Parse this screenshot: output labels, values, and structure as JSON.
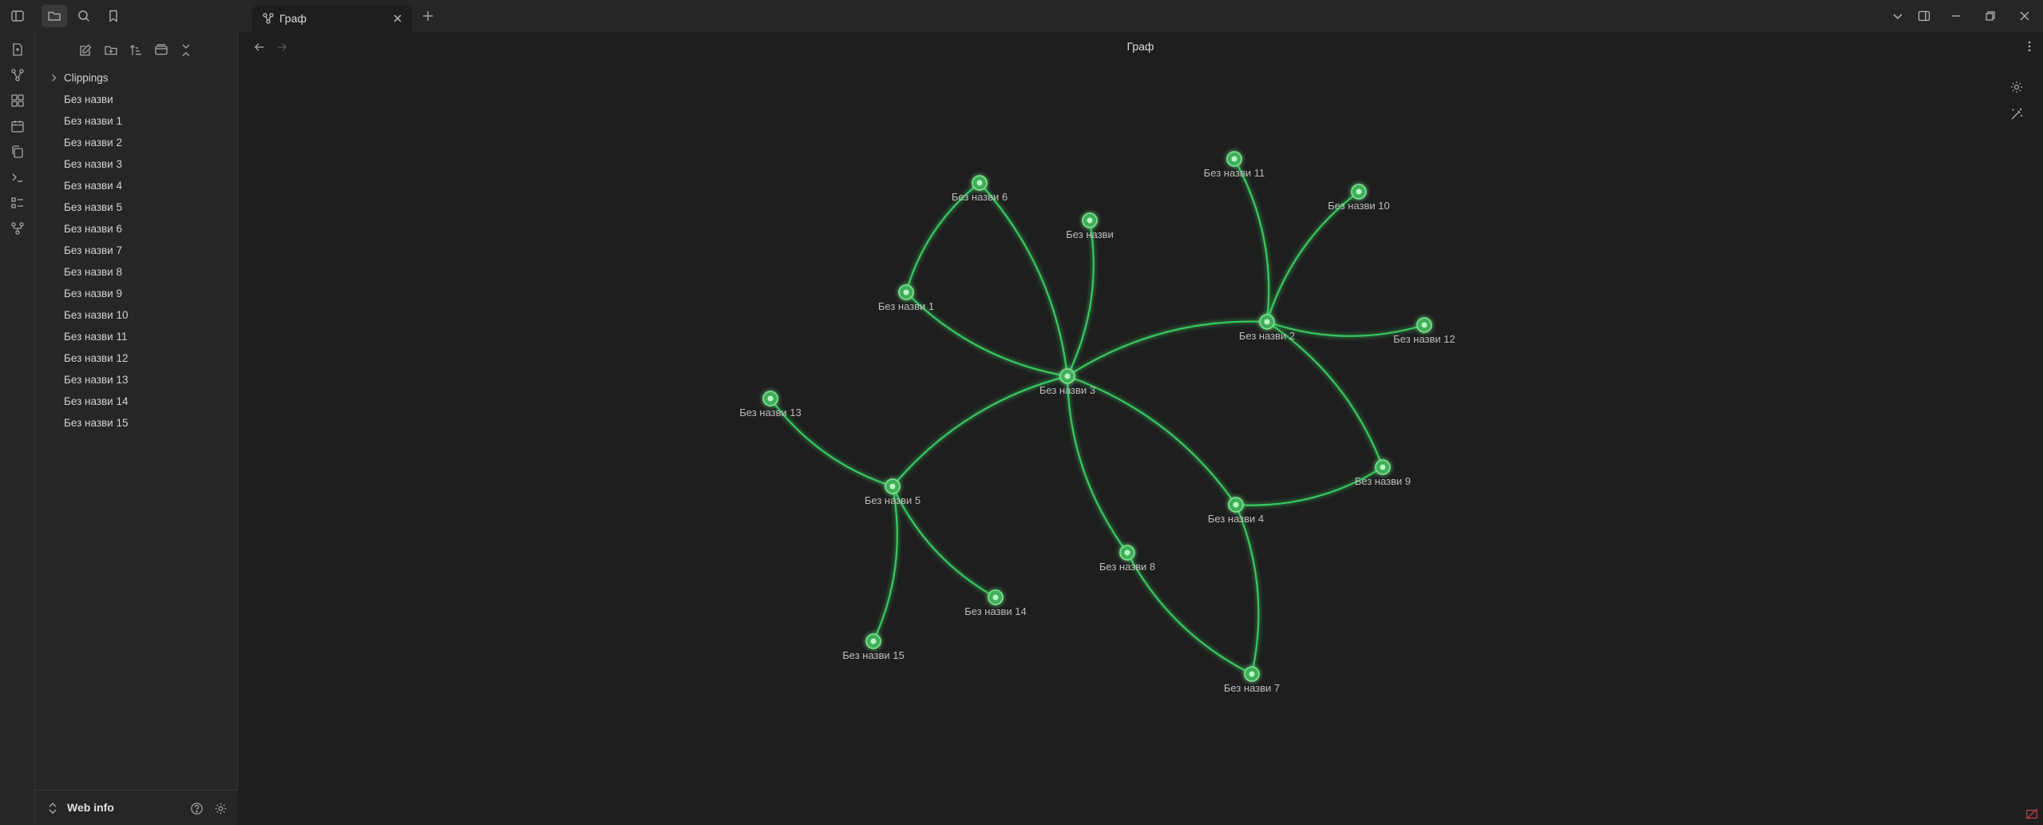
{
  "titlebar": {
    "tab_label": "Граф"
  },
  "sidebar": {
    "items": [
      {
        "label": "Clippings",
        "type": "folder"
      },
      {
        "label": "Без назви",
        "type": "file"
      },
      {
        "label": "Без назви 1",
        "type": "file"
      },
      {
        "label": "Без назви 2",
        "type": "file"
      },
      {
        "label": "Без назви 3",
        "type": "file"
      },
      {
        "label": "Без назви 4",
        "type": "file"
      },
      {
        "label": "Без назви 5",
        "type": "file"
      },
      {
        "label": "Без назви 6",
        "type": "file"
      },
      {
        "label": "Без назви 7",
        "type": "file"
      },
      {
        "label": "Без назви 8",
        "type": "file"
      },
      {
        "label": "Без назви 9",
        "type": "file"
      },
      {
        "label": "Без назви 10",
        "type": "file"
      },
      {
        "label": "Без назви 11",
        "type": "file"
      },
      {
        "label": "Без назви 12",
        "type": "file"
      },
      {
        "label": "Без назви 13",
        "type": "file"
      },
      {
        "label": "Без назви 14",
        "type": "file"
      },
      {
        "label": "Без назви 15",
        "type": "file"
      }
    ],
    "vault_name": "Web info"
  },
  "view": {
    "title": "Граф"
  },
  "graph": {
    "node_color": "#3fae5a",
    "edge_color": "#39c85e",
    "nodes": [
      {
        "id": "n",
        "label": "Без назви"
      },
      {
        "id": "n1",
        "label": "Без назви 1"
      },
      {
        "id": "n2",
        "label": "Без назви 2"
      },
      {
        "id": "n3",
        "label": "Без назви 3"
      },
      {
        "id": "n4",
        "label": "Без назви 4"
      },
      {
        "id": "n5",
        "label": "Без назви 5"
      },
      {
        "id": "n6",
        "label": "Без назви 6"
      },
      {
        "id": "n7",
        "label": "Без назви 7"
      },
      {
        "id": "n8",
        "label": "Без назви 8"
      },
      {
        "id": "n9",
        "label": "Без назви 9"
      },
      {
        "id": "n10",
        "label": "Без назви 10"
      },
      {
        "id": "n11",
        "label": "Без назви 11"
      },
      {
        "id": "n12",
        "label": "Без назви 12"
      },
      {
        "id": "n13",
        "label": "Без назви 13"
      },
      {
        "id": "n14",
        "label": "Без назви 14"
      },
      {
        "id": "n15",
        "label": "Без назви 15"
      }
    ],
    "edges": [
      [
        "n3",
        "n"
      ],
      [
        "n3",
        "n1"
      ],
      [
        "n3",
        "n6"
      ],
      [
        "n3",
        "n2"
      ],
      [
        "n3",
        "n5"
      ],
      [
        "n3",
        "n4"
      ],
      [
        "n3",
        "n8"
      ],
      [
        "n1",
        "n6"
      ],
      [
        "n2",
        "n11"
      ],
      [
        "n2",
        "n10"
      ],
      [
        "n2",
        "n12"
      ],
      [
        "n2",
        "n9"
      ],
      [
        "n4",
        "n9"
      ],
      [
        "n4",
        "n7"
      ],
      [
        "n8",
        "n7"
      ],
      [
        "n5",
        "n13"
      ],
      [
        "n5",
        "n14"
      ],
      [
        "n5",
        "n15"
      ]
    ]
  }
}
